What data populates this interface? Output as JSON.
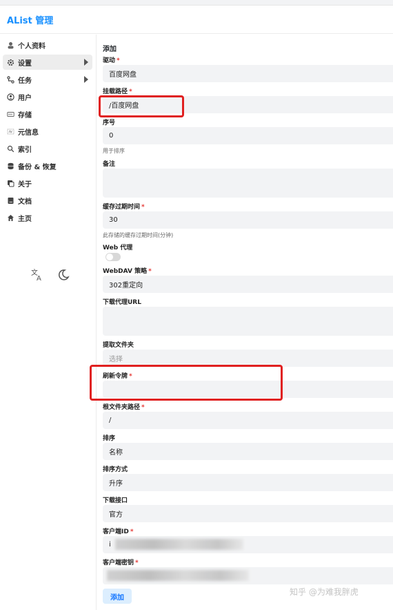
{
  "header": {
    "title": "AList 管理"
  },
  "sidebar": {
    "items": [
      {
        "label": "个人资料",
        "icon": "user-card-icon"
      },
      {
        "label": "设置",
        "icon": "gear-icon",
        "active": true,
        "has_arrow": true
      },
      {
        "label": "任务",
        "icon": "tasks-icon",
        "has_arrow": true
      },
      {
        "label": "用户",
        "icon": "user-icon"
      },
      {
        "label": "存储",
        "icon": "storage-icon"
      },
      {
        "label": "元信息",
        "icon": "meta-icon"
      },
      {
        "label": "索引",
        "icon": "search-icon"
      },
      {
        "label": "备份 & 恢复",
        "icon": "database-icon"
      },
      {
        "label": "关于",
        "icon": "copy-icon"
      },
      {
        "label": "文档",
        "icon": "book-icon"
      },
      {
        "label": "主页",
        "icon": "home-icon"
      }
    ],
    "tools": [
      "translate-icon",
      "moon-icon"
    ]
  },
  "form": {
    "title": "添加",
    "driver": {
      "label": "驱动",
      "value": "百度网盘"
    },
    "mount_path": {
      "label": "挂载路径",
      "value": "/百度网盘"
    },
    "order": {
      "label": "序号",
      "value": "0",
      "hint": "用于排序"
    },
    "remark": {
      "label": "备注",
      "value": ""
    },
    "cache_expiration": {
      "label": "缓存过期时间",
      "value": "30",
      "hint": "此存储的缓存过期时间(分钟)"
    },
    "web_proxy": {
      "label": "Web 代理",
      "enabled": false
    },
    "webdav_policy": {
      "label": "WebDAV 策略",
      "value": "302重定向"
    },
    "down_proxy_url": {
      "label": "下载代理URL",
      "value": ""
    },
    "extract_folder": {
      "label": "提取文件夹",
      "placeholder": "选择"
    },
    "refresh_token": {
      "label": "刷新令牌",
      "value": ""
    },
    "root_folder_path": {
      "label": "根文件夹路径",
      "value": "/"
    },
    "order_by": {
      "label": "排序",
      "value": "名称"
    },
    "order_direction": {
      "label": "排序方式",
      "value": "升序"
    },
    "download_api": {
      "label": "下载接口",
      "value": "官方"
    },
    "client_id": {
      "label": "客户端ID",
      "value": "i"
    },
    "client_secret": {
      "label": "客户端密钥",
      "value": ""
    },
    "submit_label": "添加",
    "required_mark": "*"
  },
  "watermark": "知乎 @为难我胖虎",
  "colors": {
    "accent": "#1890ff",
    "required": "#e53935",
    "highlight": "#e02020",
    "field_bg": "#f2f3f5"
  }
}
